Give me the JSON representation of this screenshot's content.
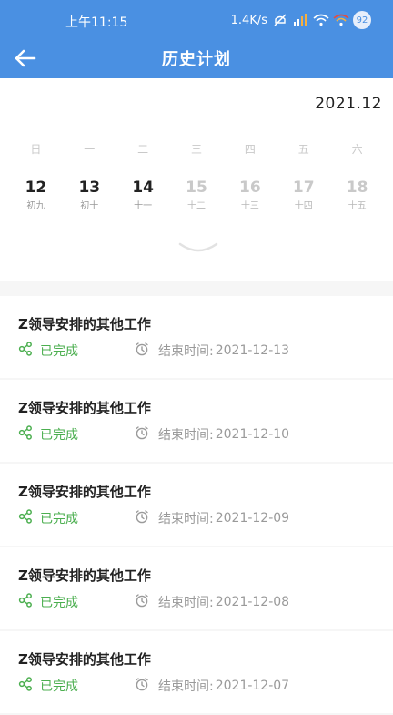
{
  "status_bar": {
    "time": "上午11:15",
    "speed": "1.4K/s",
    "battery": "92"
  },
  "header": {
    "title": "历史计划"
  },
  "calendar": {
    "month": "2021.12",
    "weekdays": [
      "日",
      "一",
      "二",
      "三",
      "四",
      "五",
      "六"
    ],
    "days": [
      {
        "num": "12",
        "lunar": "初九",
        "state": "active"
      },
      {
        "num": "13",
        "lunar": "初十",
        "state": "active"
      },
      {
        "num": "14",
        "lunar": "十一",
        "state": "active"
      },
      {
        "num": "15",
        "lunar": "十二",
        "state": "disabled"
      },
      {
        "num": "16",
        "lunar": "十三",
        "state": "disabled"
      },
      {
        "num": "17",
        "lunar": "十四",
        "state": "disabled"
      },
      {
        "num": "18",
        "lunar": "十五",
        "state": "disabled"
      }
    ]
  },
  "plans": [
    {
      "title": "Z领导安排的其他工作",
      "status": "已完成",
      "end_label": "结束时间:",
      "end_date": "2021-12-13"
    },
    {
      "title": "Z领导安排的其他工作",
      "status": "已完成",
      "end_label": "结束时间:",
      "end_date": "2021-12-10"
    },
    {
      "title": "Z领导安排的其他工作",
      "status": "已完成",
      "end_label": "结束时间:",
      "end_date": "2021-12-09"
    },
    {
      "title": "Z领导安排的其他工作",
      "status": "已完成",
      "end_label": "结束时间:",
      "end_date": "2021-12-08"
    },
    {
      "title": "Z领导安排的其他工作",
      "status": "已完成",
      "end_label": "结束时间:",
      "end_date": "2021-12-07"
    }
  ],
  "colors": {
    "primary": "#4a90e2",
    "done": "#4caf50"
  }
}
